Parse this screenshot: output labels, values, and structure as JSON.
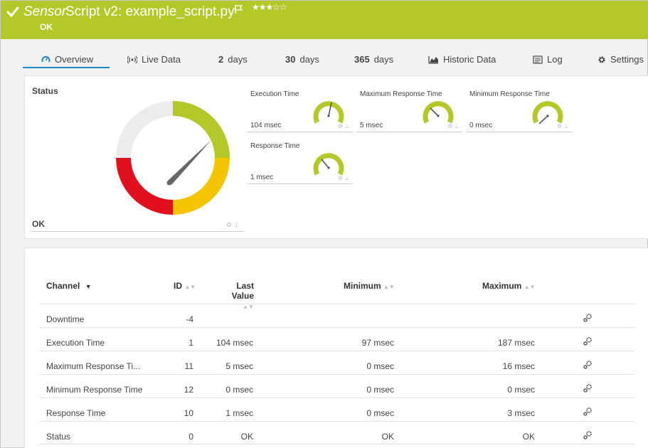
{
  "header": {
    "sensor_word": "Sensor",
    "title": "Script v2: example_script.py",
    "stars": "★★★☆☆",
    "status": "OK",
    "color": "#b4c829"
  },
  "tabs": [
    {
      "label": "Overview",
      "icon": "overview-icon",
      "active": true
    },
    {
      "label": "Live Data",
      "icon": "live-data-icon"
    },
    {
      "num": "2",
      "label": "days"
    },
    {
      "num": "30",
      "label": "days"
    },
    {
      "num": "365",
      "label": "days"
    },
    {
      "label": "Historic Data",
      "icon": "chart-icon"
    },
    {
      "label": "Log",
      "icon": "log-icon"
    },
    {
      "label": "Settings",
      "icon": "gear-icon"
    }
  ],
  "status_gauge": {
    "label": "Status",
    "value": "OK",
    "colors": {
      "ok": "#b4c829",
      "warning": "#f5c400",
      "error": "#e1101e",
      "unused": "#ececec"
    }
  },
  "gauges": [
    {
      "label": "Execution Time",
      "value": "104 msec"
    },
    {
      "label": "Maximum Response Time",
      "value": "5 msec"
    },
    {
      "label": "Minimum Response Time",
      "value": "0 msec"
    },
    {
      "label": "Response Time",
      "value": "1 msec"
    }
  ],
  "table": {
    "headers": {
      "channel": "Channel",
      "id": "ID",
      "last_line1": "Last",
      "last_line2": "Value",
      "minimum": "Minimum",
      "maximum": "Maximum"
    },
    "rows": [
      {
        "channel": "Downtime",
        "id": "-4",
        "last": "",
        "min": "",
        "max": ""
      },
      {
        "channel": "Execution Time",
        "id": "1",
        "last": "104 msec",
        "min": "97 msec",
        "max": "187 msec"
      },
      {
        "channel": "Maximum Response Ti...",
        "id": "11",
        "last": "5 msec",
        "min": "0 msec",
        "max": "16 msec"
      },
      {
        "channel": "Minimum Response Time",
        "id": "12",
        "last": "0 msec",
        "min": "0 msec",
        "max": "0 msec"
      },
      {
        "channel": "Response Time",
        "id": "10",
        "last": "1 msec",
        "min": "0 msec",
        "max": "3 msec"
      },
      {
        "channel": "Status",
        "id": "0",
        "last": "OK",
        "min": "OK",
        "max": "OK"
      }
    ]
  }
}
